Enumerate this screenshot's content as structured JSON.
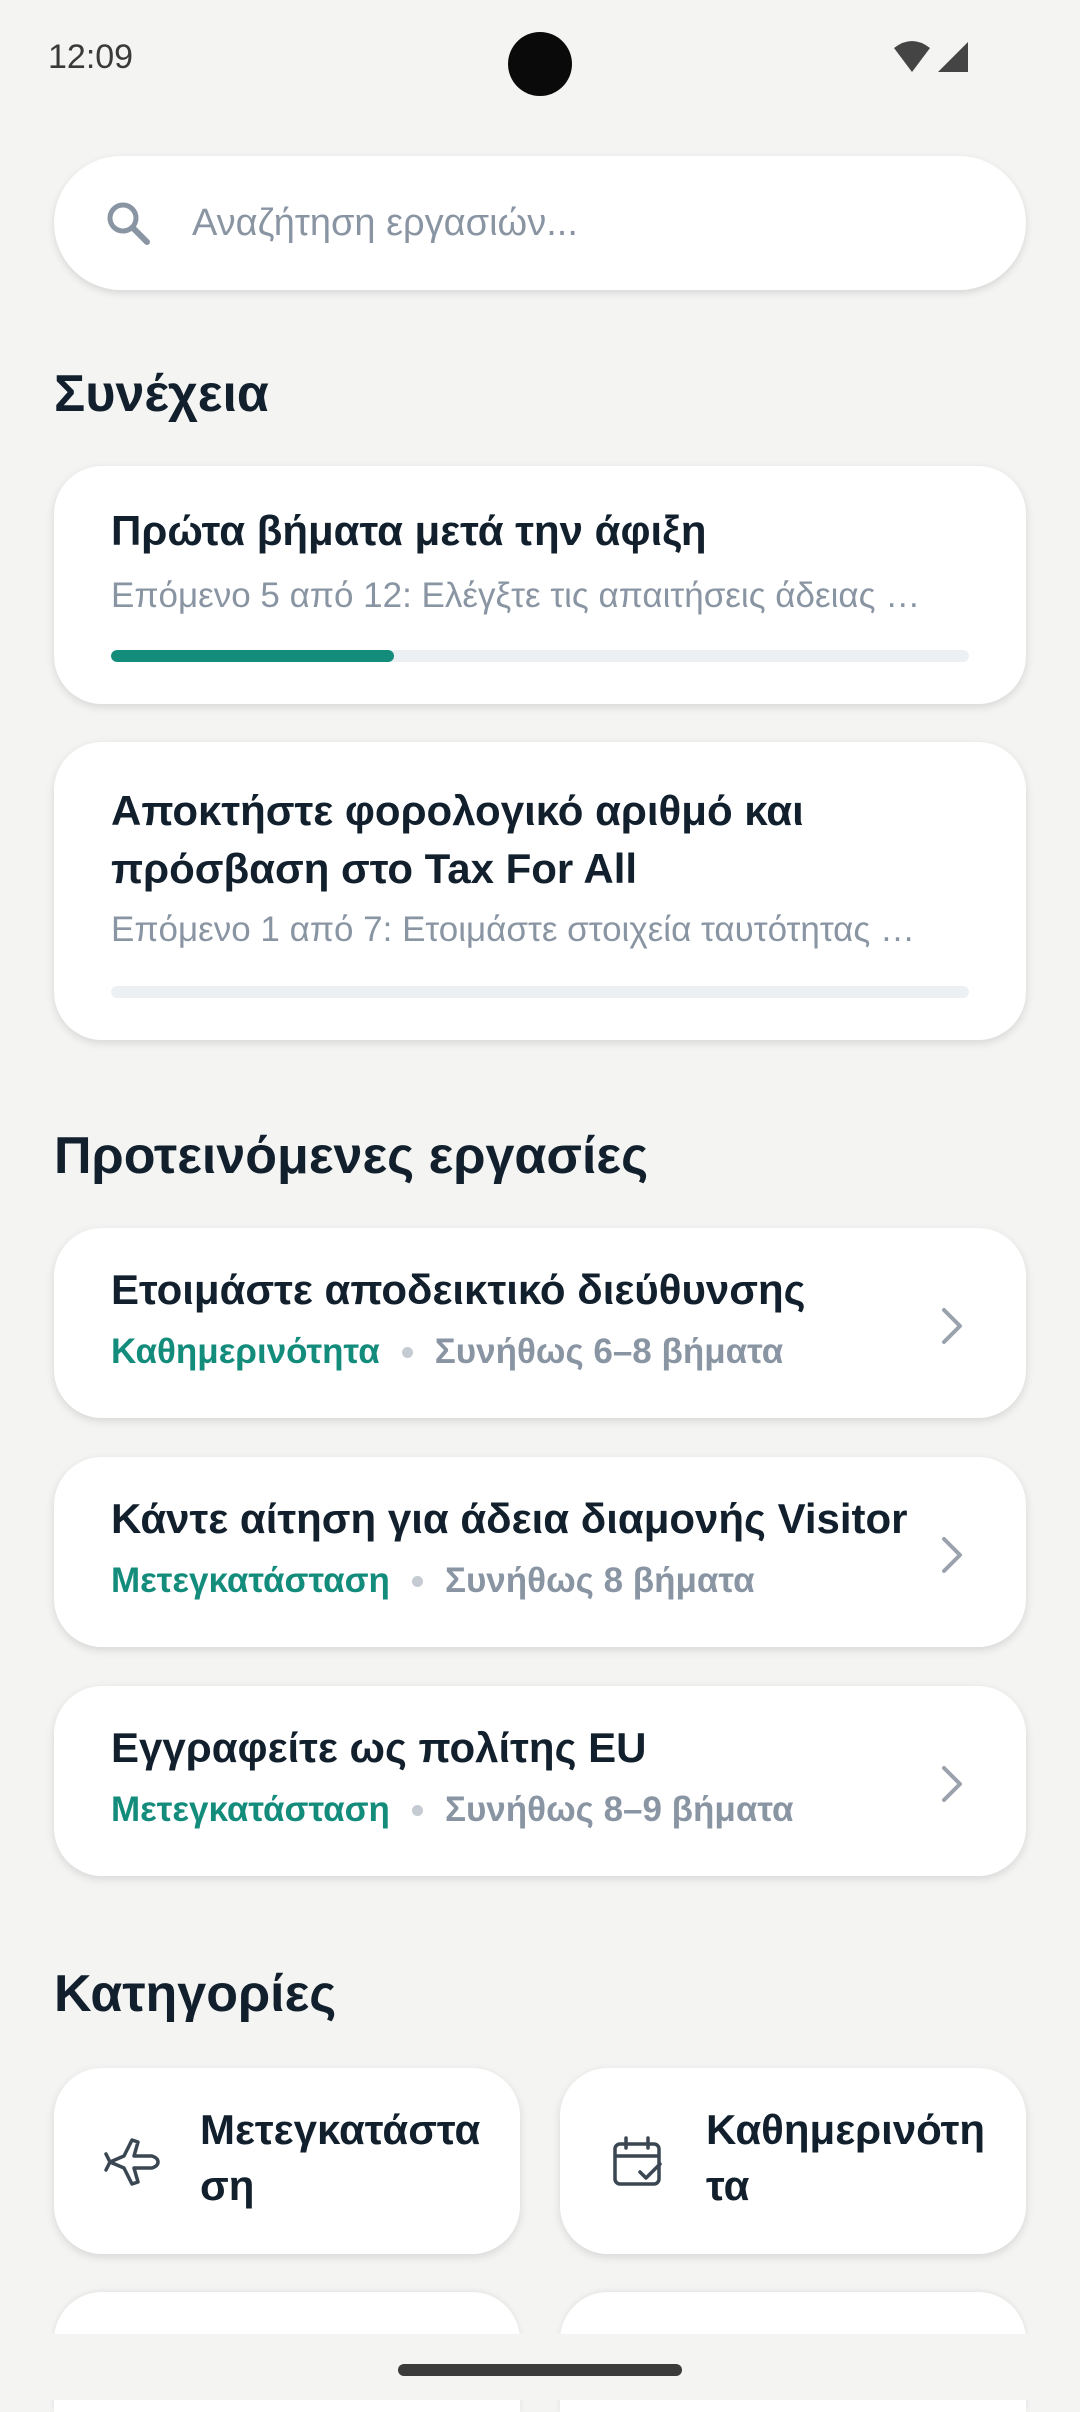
{
  "status_bar": {
    "time": "12:09"
  },
  "search": {
    "placeholder": "Αναζήτηση εργασιών..."
  },
  "continue_section": {
    "title": "Συνέχεια",
    "items": [
      {
        "title": "Πρώτα βήματα μετά την άφιξη",
        "subtitle": "Επόμενο 5 από 12: Ελέγξτε τις απαιτήσεις άδειας …",
        "progress": 0.33
      },
      {
        "title": "Αποκτήστε φορολογικό αριθμό και πρόσβαση στο Tax For All",
        "subtitle": "Επόμενο 1 από 7: Ετοιμάστε στοιχεία ταυτότητας …",
        "progress": 0.0
      }
    ]
  },
  "suggested_section": {
    "title": "Προτεινόμενες εργασίες",
    "items": [
      {
        "title": "Ετοιμάστε αποδεικτικό διεύθυνσης",
        "category": "Καθημερινότητα",
        "steps": "Συνήθως 6–8 βήματα"
      },
      {
        "title": "Κάντε αίτηση για άδεια διαμονής Visitor",
        "category": "Μετεγκατάσταση",
        "steps": "Συνήθως 8 βήματα"
      },
      {
        "title": "Εγγραφείτε ως πολίτης EU",
        "category": "Μετεγκατάσταση",
        "steps": "Συνήθως 8–9 βήματα"
      }
    ]
  },
  "categories_section": {
    "title": "Κατηγορίες",
    "items": [
      {
        "label": "Μετεγκατάσταση",
        "icon": "airplane-icon"
      },
      {
        "label": "Καθημερινότητα",
        "icon": "calendar-check-icon"
      }
    ]
  },
  "colors": {
    "accent": "#138c7c",
    "muted": "#8a95a3",
    "text": "#12202e",
    "background": "#f4f4f3"
  }
}
